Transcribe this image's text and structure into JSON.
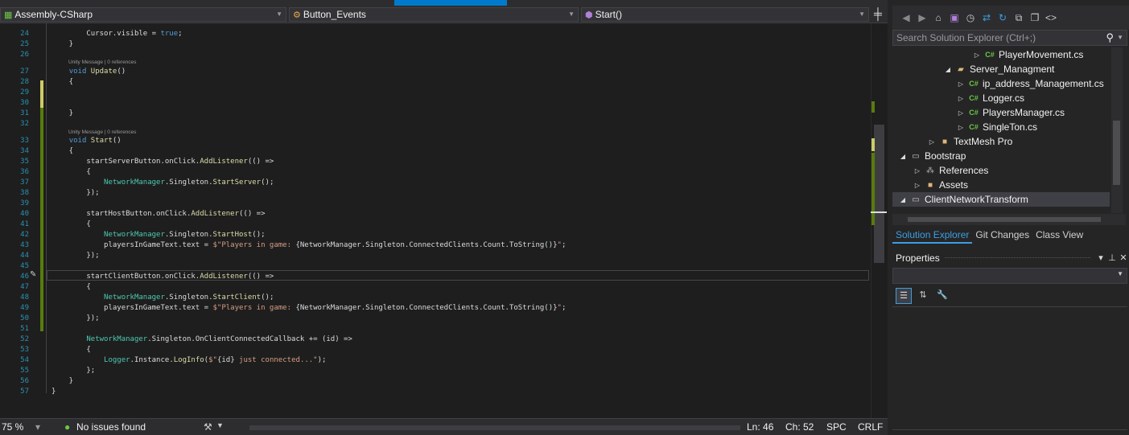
{
  "navbar": {
    "project": "Assembly-CSharp",
    "class_member": "Button_Events",
    "method": "Start()"
  },
  "code": {
    "lines": [
      {
        "n": "24",
        "t": "        Cursor.visible = true;"
      },
      {
        "n": "25",
        "t": "    }"
      },
      {
        "n": "26",
        "t": ""
      },
      {
        "n": "27",
        "t": "    void Update()"
      },
      {
        "n": "28",
        "t": "    {"
      },
      {
        "n": "29",
        "t": ""
      },
      {
        "n": "30",
        "t": ""
      },
      {
        "n": "31",
        "t": "    }"
      },
      {
        "n": "32",
        "t": ""
      },
      {
        "n": "33",
        "t": "    void Start()"
      },
      {
        "n": "34",
        "t": "    {"
      },
      {
        "n": "35",
        "t": "        startServerButton.onClick.AddListener(() =>"
      },
      {
        "n": "36",
        "t": "        {"
      },
      {
        "n": "37",
        "t": "            NetworkManager.Singleton.StartServer();"
      },
      {
        "n": "38",
        "t": "        });"
      },
      {
        "n": "39",
        "t": ""
      },
      {
        "n": "40",
        "t": "        startHostButton.onClick.AddListener(() =>"
      },
      {
        "n": "41",
        "t": "        {"
      },
      {
        "n": "42",
        "t": "            NetworkManager.Singleton.StartHost();"
      },
      {
        "n": "43",
        "t": "            playersInGameText.text = $\"Players in game: {NetworkManager.Singleton.ConnectedClients.Count.ToString()}\";"
      },
      {
        "n": "44",
        "t": "        });"
      },
      {
        "n": "45",
        "t": ""
      },
      {
        "n": "46",
        "t": "        startClientButton.onClick.AddListener(() =>"
      },
      {
        "n": "47",
        "t": "        {"
      },
      {
        "n": "48",
        "t": "            NetworkManager.Singleton.StartClient();"
      },
      {
        "n": "49",
        "t": "            playersInGameText.text = $\"Players in game: {NetworkManager.Singleton.ConnectedClients.Count.ToString()}\";"
      },
      {
        "n": "50",
        "t": "        });"
      },
      {
        "n": "51",
        "t": ""
      },
      {
        "n": "52",
        "t": "        NetworkManager.Singleton.OnClientConnectedCallback += (id) =>"
      },
      {
        "n": "53",
        "t": "        {"
      },
      {
        "n": "54",
        "t": "            Logger.Instance.LogInfo($\"{id} just connected...\");"
      },
      {
        "n": "55",
        "t": "        };"
      },
      {
        "n": "56",
        "t": "    }"
      },
      {
        "n": "57",
        "t": "}"
      }
    ],
    "lens_update": "Unity Message | 0 references",
    "lens_start": "Unity Message | 0 references"
  },
  "status": {
    "zoom": "75 %",
    "issues": "No issues found",
    "ln": "Ln: 46",
    "ch": "Ch: 52",
    "ins": "SPC",
    "eol": "CRLF"
  },
  "solution_explorer": {
    "search_placeholder": "Search Solution Explorer (Ctrl+;)",
    "items": [
      {
        "label": "PlayerMovement.cs",
        "icon": "csharp-file-icon"
      },
      {
        "label": "Server_Managment",
        "icon": "folder-open-icon"
      },
      {
        "label": "ip_address_Management.cs",
        "icon": "csharp-file-icon"
      },
      {
        "label": "Logger.cs",
        "icon": "csharp-file-icon"
      },
      {
        "label": "PlayersManager.cs",
        "icon": "csharp-file-icon"
      },
      {
        "label": "SingleTon.cs",
        "icon": "csharp-file-icon"
      },
      {
        "label": "TextMesh Pro",
        "icon": "folder-icon"
      },
      {
        "label": "Bootstrap",
        "icon": "project-icon"
      },
      {
        "label": "References",
        "icon": "references-icon"
      },
      {
        "label": "Assets",
        "icon": "folder-icon"
      },
      {
        "label": "ClientNetworkTransform",
        "icon": "project-icon"
      }
    ],
    "tabs": [
      "Solution Explorer",
      "Git Changes",
      "Class View"
    ]
  },
  "properties": {
    "title": "Properties"
  },
  "colors": {
    "accent": "#007acc",
    "keyword": "#569cd6",
    "type": "#4ec9b0",
    "method": "#dcdcaa",
    "string": "#d69d85",
    "line_number": "#2b91af"
  }
}
